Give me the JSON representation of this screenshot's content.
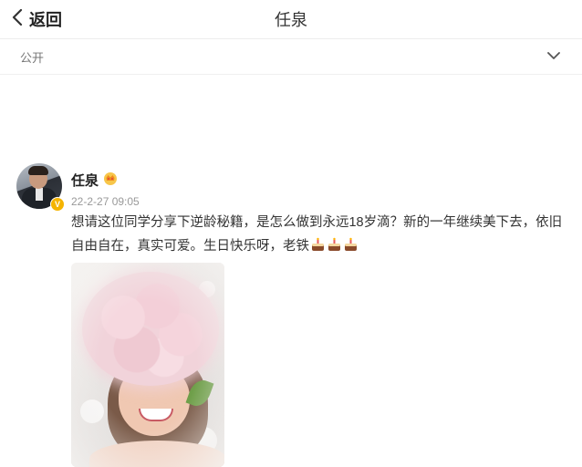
{
  "header": {
    "back_label": "返回",
    "title": "任泉"
  },
  "visibility": {
    "label": "公开"
  },
  "post": {
    "author": "任泉",
    "verified_badge": "V",
    "timestamp": "22-2-27 09:05",
    "text": "想请这位同学分享下逆龄秘籍，是怎么做到永远18岁滴？新的一年继续美下去，依旧自由自在，真实可爱。生日快乐呀，老铁",
    "emojis": [
      "cake-icon",
      "cake-icon",
      "cake-icon"
    ]
  },
  "colors": {
    "verified": "#f5b400",
    "text": "#333333",
    "muted": "#999999"
  }
}
